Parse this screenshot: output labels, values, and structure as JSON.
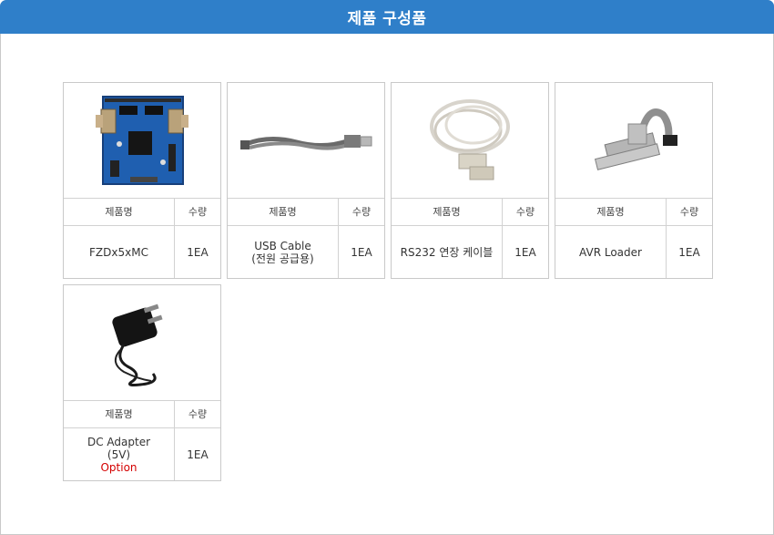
{
  "header": {
    "title": "제품 구성품"
  },
  "table_labels": {
    "name": "제품명",
    "qty": "수량"
  },
  "products": [
    {
      "name_line1": "FZDx5xMC",
      "name_line2": "",
      "note": "",
      "qty": "1EA",
      "image": "board-photo"
    },
    {
      "name_line1": "USB Cable",
      "name_line2": "(전원 공급용)",
      "note": "",
      "qty": "1EA",
      "image": "usb-cable-photo"
    },
    {
      "name_line1": "RS232 연장 케이블",
      "name_line2": "",
      "note": "",
      "qty": "1EA",
      "image": "serial-cable-photo"
    },
    {
      "name_line1": "AVR Loader",
      "name_line2": "",
      "note": "",
      "qty": "1EA",
      "image": "avr-loader-photo"
    },
    {
      "name_line1": "DC Adapter",
      "name_line2": "(5V)",
      "note": "Option",
      "qty": "1EA",
      "image": "dc-adapter-photo"
    }
  ],
  "colors": {
    "header_bg": "#2f7fc9",
    "option_text": "#d40000",
    "border": "#c9c9c9"
  }
}
